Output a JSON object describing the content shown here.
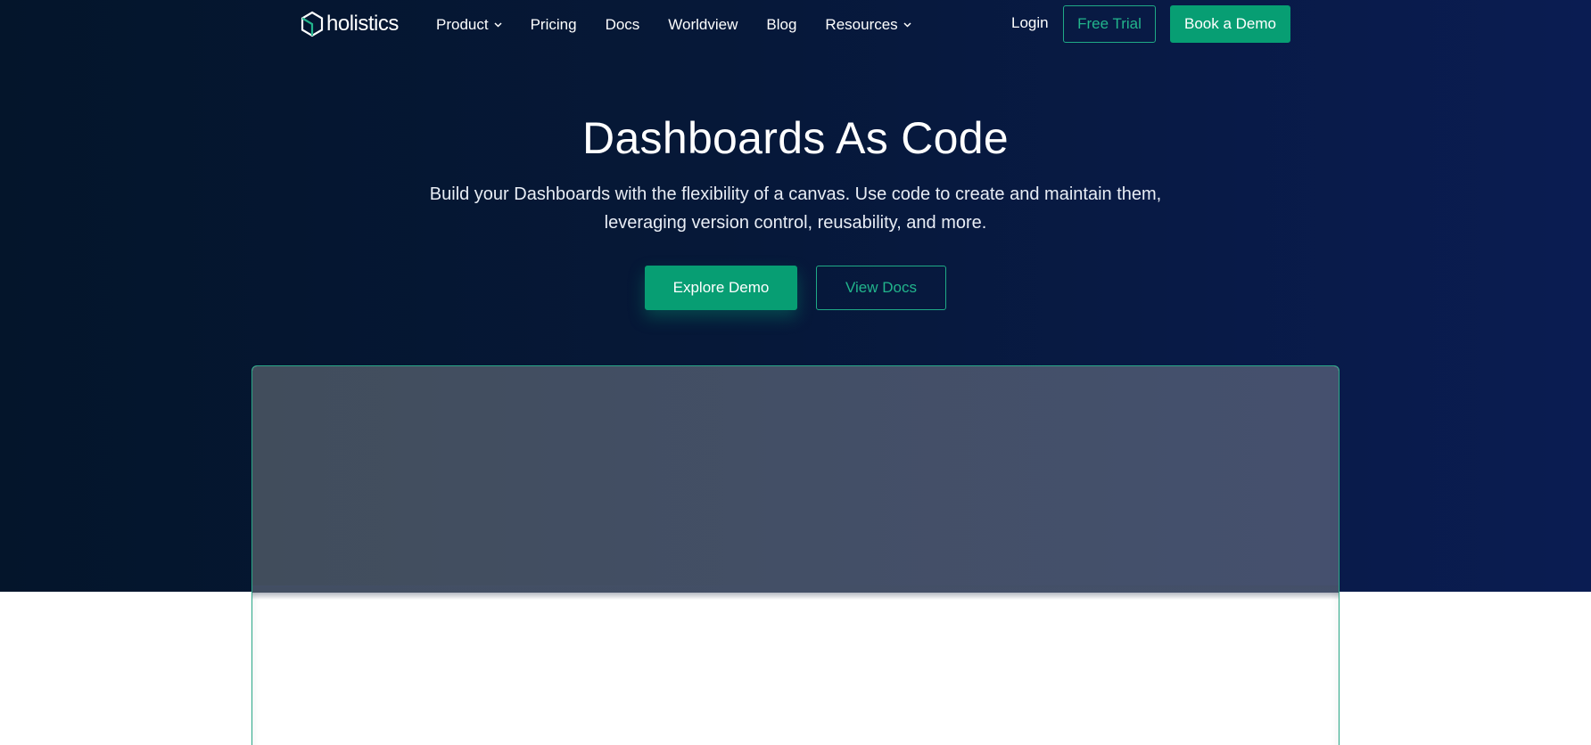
{
  "brand": {
    "name": "holistics",
    "accent": "#079e73",
    "accent_text": "#22b58c",
    "hero_bg_left": "#04152b",
    "hero_bg_right": "#0a1c52"
  },
  "nav": {
    "items": [
      {
        "label": "Product",
        "icon": "chevron-down-icon"
      },
      {
        "label": "Pricing"
      },
      {
        "label": "Docs"
      },
      {
        "label": "Worldview"
      },
      {
        "label": "Blog"
      },
      {
        "label": "Resources",
        "icon": "chevron-down-icon"
      }
    ],
    "login": "Login",
    "free_trial": "Free Trial",
    "book_demo": "Book a Demo"
  },
  "hero": {
    "title": "Dashboards As Code",
    "subtitle": "Build your Dashboards with the flexibility of a canvas. Use code to create and maintain them, leveraging version control, reusability, and more.",
    "explore_demo": "Explore Demo",
    "view_docs": "View Docs"
  }
}
